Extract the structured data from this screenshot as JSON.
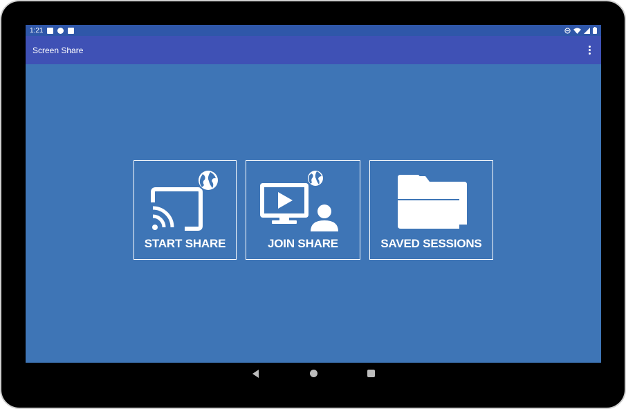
{
  "status_bar": {
    "time": "1:21",
    "left_icons": [
      "notification-a-icon",
      "notification-p-icon",
      "sd-card-icon"
    ],
    "right_icons": [
      "do-not-disturb-icon",
      "wifi-icon",
      "signal-icon",
      "battery-icon"
    ]
  },
  "app_bar": {
    "title": "Screen Share",
    "menu_icon": "more-vert-icon"
  },
  "tiles": [
    {
      "label": "START SHARE",
      "icon": "cast-globe-icon"
    },
    {
      "label": "JOIN SHARE",
      "icon": "monitor-play-user-icon"
    },
    {
      "label": "SAVED SESSIONS",
      "icon": "folder-icon"
    }
  ],
  "nav_bar": {
    "buttons": [
      "back-icon",
      "home-icon",
      "recents-icon"
    ]
  },
  "colors": {
    "content_bg": "#3e75b6",
    "app_bar": "#3f51b5",
    "status_bar": "#2f57a9",
    "foreground": "#ffffff"
  }
}
